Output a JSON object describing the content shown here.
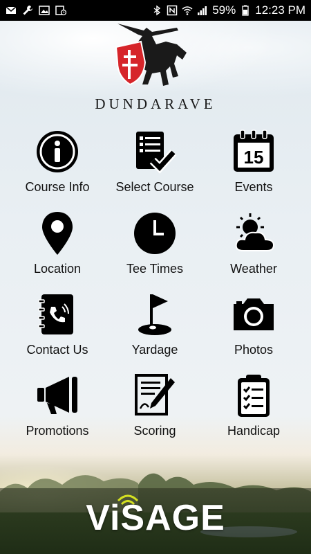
{
  "status_bar": {
    "battery": "59%",
    "time": "12:23 PM",
    "icons_left": [
      "mail-icon",
      "wrench-icon",
      "image-icon",
      "clock-icon"
    ],
    "icons_right": [
      "bluetooth-icon",
      "nfc-icon",
      "wifi-icon",
      "signal-icon",
      "battery-icon"
    ]
  },
  "header": {
    "brand": "DUNDARAVE"
  },
  "menu": [
    {
      "label": "Course Info",
      "icon": "info-icon"
    },
    {
      "label": "Select Course",
      "icon": "checklist-icon"
    },
    {
      "label": "Events",
      "icon": "calendar-icon",
      "badge": "15"
    },
    {
      "label": "Location",
      "icon": "location-pin-icon"
    },
    {
      "label": "Tee Times",
      "icon": "clock-icon"
    },
    {
      "label": "Weather",
      "icon": "weather-icon"
    },
    {
      "label": "Contact Us",
      "icon": "contact-book-icon"
    },
    {
      "label": "Yardage",
      "icon": "golf-flag-icon"
    },
    {
      "label": "Photos",
      "icon": "camera-icon"
    },
    {
      "label": "Promotions",
      "icon": "megaphone-icon"
    },
    {
      "label": "Scoring",
      "icon": "scorecard-icon"
    },
    {
      "label": "Handicap",
      "icon": "clipboard-icon"
    }
  ],
  "footer": {
    "brand": "ViSAGE"
  },
  "colors": {
    "icon": "#000000",
    "text": "#111111",
    "status_bar": "#000000",
    "shield": "#d6252a"
  }
}
